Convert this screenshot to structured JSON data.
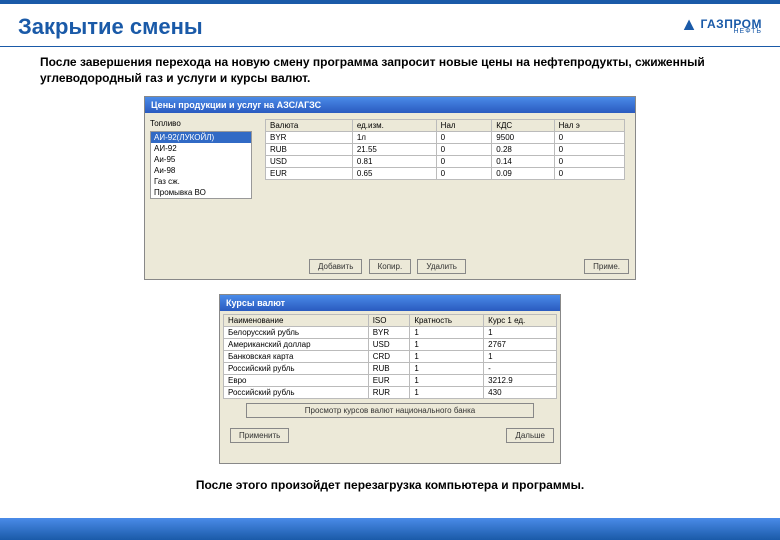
{
  "page": {
    "title": "Закрытие смены",
    "intro": "После завершения перехода на новую смену программа запросит новые цены на нефтепродукты, сжиженный углеводородный газ и услуги  и курсы валют.",
    "outro": "После этого произойдет перезагрузка компьютера и программы."
  },
  "logo": {
    "main": "ГАЗПРОМ",
    "sub": "НЕФТЬ"
  },
  "window1": {
    "title": "Цены продукции и услуг на АЗС/АГЗС",
    "left_label": "Топливо",
    "products": [
      "АИ-92(ЛУКОЙЛ)",
      "АИ-92",
      "Аи-95",
      "Аи-98",
      "Газ сж.",
      "Промывка ВО"
    ],
    "columns": [
      "Валюта",
      "ед.изм.",
      "Нал",
      "КДС",
      "Нал э"
    ],
    "rows": [
      [
        "BYR",
        "1л",
        "0",
        "9500",
        "0"
      ],
      [
        "RUB",
        "21.55",
        "0",
        "0.28",
        "0"
      ],
      [
        "USD",
        "0.81",
        "0",
        "0.14",
        "0"
      ],
      [
        "EUR",
        "0.65",
        "0",
        "0.09",
        "0"
      ]
    ],
    "buttons": {
      "b1": "Добавить",
      "b2": "Копир.",
      "b3": "Удалить",
      "close": "Приме."
    }
  },
  "window2": {
    "title": "Курсы валют",
    "columns": [
      "Наименование",
      "ISO",
      "Кратность",
      "Курс 1 ед."
    ],
    "rows": [
      [
        "Белорусский рубль",
        "BYR",
        "1",
        "1"
      ],
      [
        "Американский доллар",
        "USD",
        "1",
        "2767"
      ],
      [
        "Банковская карта",
        "CRD",
        "1",
        "1"
      ],
      [
        "Российский рубль",
        "RUB",
        "1",
        "-"
      ],
      [
        "Евро",
        "EUR",
        "1",
        "3212.9"
      ],
      [
        "Российский рубль",
        "RUR",
        "1",
        "430"
      ]
    ],
    "wide_button": "Просмотр курсов валют национального банка",
    "buttons": {
      "left": "Применить",
      "right": "Дальше"
    }
  }
}
